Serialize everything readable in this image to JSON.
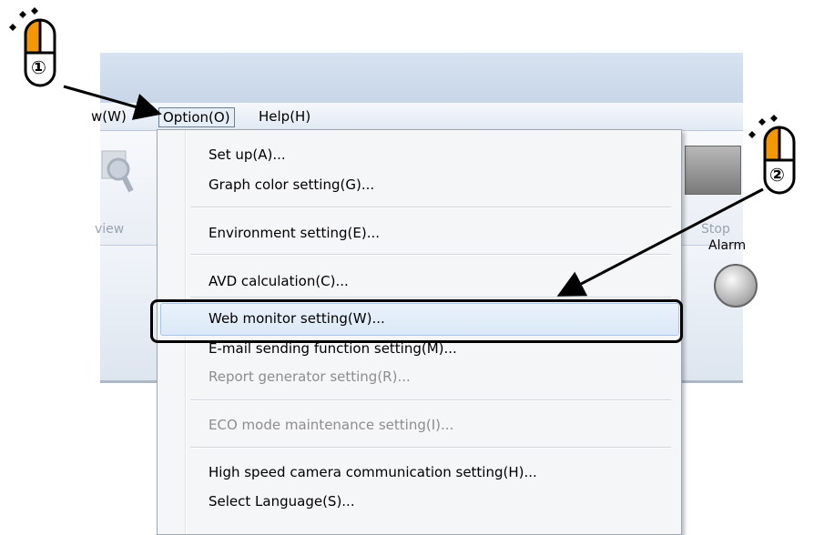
{
  "menubar": {
    "view_label": "w(W)",
    "option_label": "Option(O)",
    "help_label": "Help(H)"
  },
  "toolbar": {
    "view_label": "view",
    "stop_label": "Stop"
  },
  "content": {
    "alarm_label": "Alarm"
  },
  "dropdown": {
    "items": [
      {
        "label": "Set up(A)..."
      },
      {
        "label": "Graph color setting(G)..."
      },
      {
        "label": "Environment setting(E)..."
      },
      {
        "label": "AVD calculation(C)..."
      },
      {
        "label": "Web monitor setting(W)..."
      },
      {
        "label": "E-mail sending function setting(M)..."
      },
      {
        "label": "Report generator setting(R)..."
      },
      {
        "label": "ECO mode maintenance setting(I)..."
      },
      {
        "label": "High speed camera communication setting(H)..."
      },
      {
        "label": "Select Language(S)..."
      }
    ]
  },
  "steps": {
    "step1": "①",
    "step2": "②"
  },
  "colors": {
    "mouse_button": "#f39800",
    "highlight_border": "#000000"
  }
}
